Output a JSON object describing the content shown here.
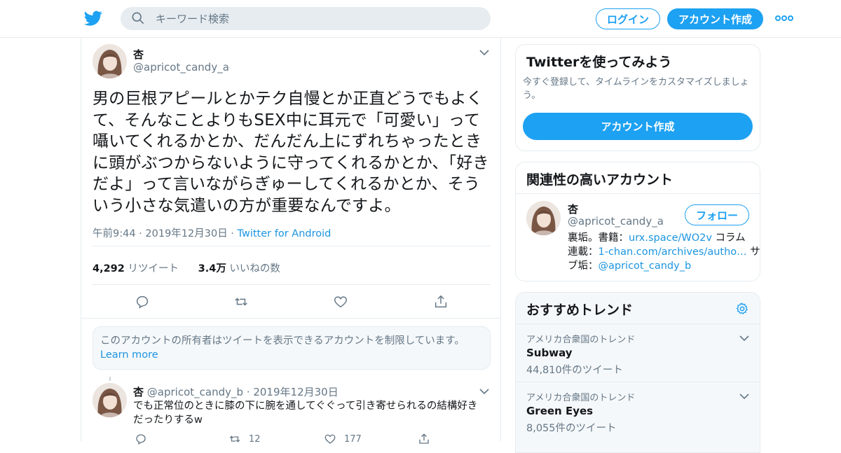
{
  "header": {
    "search_placeholder": "キーワード検索",
    "login_label": "ログイン",
    "signup_label": "アカウント作成"
  },
  "tweet": {
    "name": "杏",
    "handle": "@apricot_candy_a",
    "text": "男の巨根アピールとかテク自慢とか正直どうでもよくて、そんなことよりもSEX中に耳元で「可愛い」って囁いてくれるかとか、だんだん上にずれちゃったときに頭がぶつからないように守ってくれるかとか、「好きだよ」って言いながらぎゅーしてくれるかとか、そういう小さな気遣いの方が重要なんですよ。",
    "time": "午前9:44 · 2019年12月30日",
    "sep": " · ",
    "source": "Twitter for Android",
    "retweets": "4,292",
    "retweets_label": "リツイート",
    "likes": "3.4万",
    "likes_label": "いいねの数"
  },
  "withheld": {
    "text": "このアカウントの所有者はツイートを表示できるアカウントを制限しています。",
    "link": "Learn more"
  },
  "reply": {
    "name": "杏",
    "handle": "@apricot_candy_b",
    "date": "· 2019年12月30日",
    "text": "でも正常位のときに膝の下に腕を通してぐぐって引き寄せられるの結構好きだったりするw",
    "retweets": "12",
    "likes": "177"
  },
  "signup_card": {
    "title": "Twitterを使ってみよう",
    "desc": "今すぐ登録して、タイムラインをカスタマイズしましょう。",
    "button": "アカウント作成"
  },
  "related": {
    "title": "関連性の高いアカウント",
    "name": "杏",
    "handle": "@apricot_candy_a",
    "follow": "フォロー",
    "bio_1a": "裏垢。書籍：",
    "bio_1link": "urx.space/WO2v",
    "bio_1b": " コラム",
    "bio_2a": "連載：",
    "bio_2link": "1-chan.com/archives/autho…",
    "bio_2b": " サ",
    "bio_3a": "ブ垢：",
    "bio_3link": "@apricot_candy_b"
  },
  "trends": {
    "title": "おすすめトレンド",
    "items": [
      {
        "context": "アメリカ合衆国のトレンド",
        "name": "Subway",
        "count": "44,810件のツイート"
      },
      {
        "context": "アメリカ合衆国のトレンド",
        "name": "Green Eyes",
        "count": "8,055件のツイート"
      }
    ]
  },
  "colors": {
    "accent": "#1da1f2",
    "link": "#1b95e0",
    "muted": "#657786",
    "border": "#e6ecf0"
  },
  "icons": [
    "twitter-bird-icon",
    "search-icon",
    "more-icon",
    "chevron-down-icon",
    "reply-icon",
    "retweet-icon",
    "like-icon",
    "share-icon",
    "gear-icon"
  ]
}
